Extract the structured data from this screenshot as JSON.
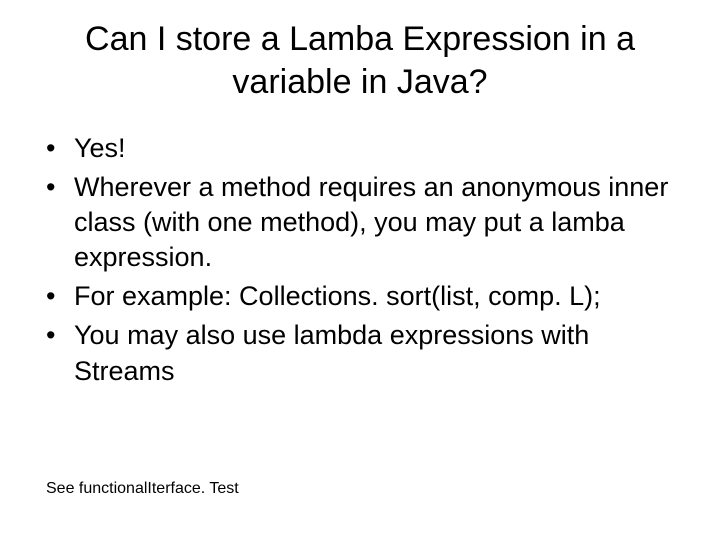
{
  "slide": {
    "title": "Can I store a Lamba Expression in a variable in Java?",
    "bullets": [
      "Yes!",
      "Wherever a method requires an anonymous inner class (with one method), you may put a lamba expression.",
      "For example:  Collections. sort(list, comp. L);",
      "You may also use lambda expressions with Streams"
    ],
    "footnote": "See functionalIterface. Test"
  }
}
